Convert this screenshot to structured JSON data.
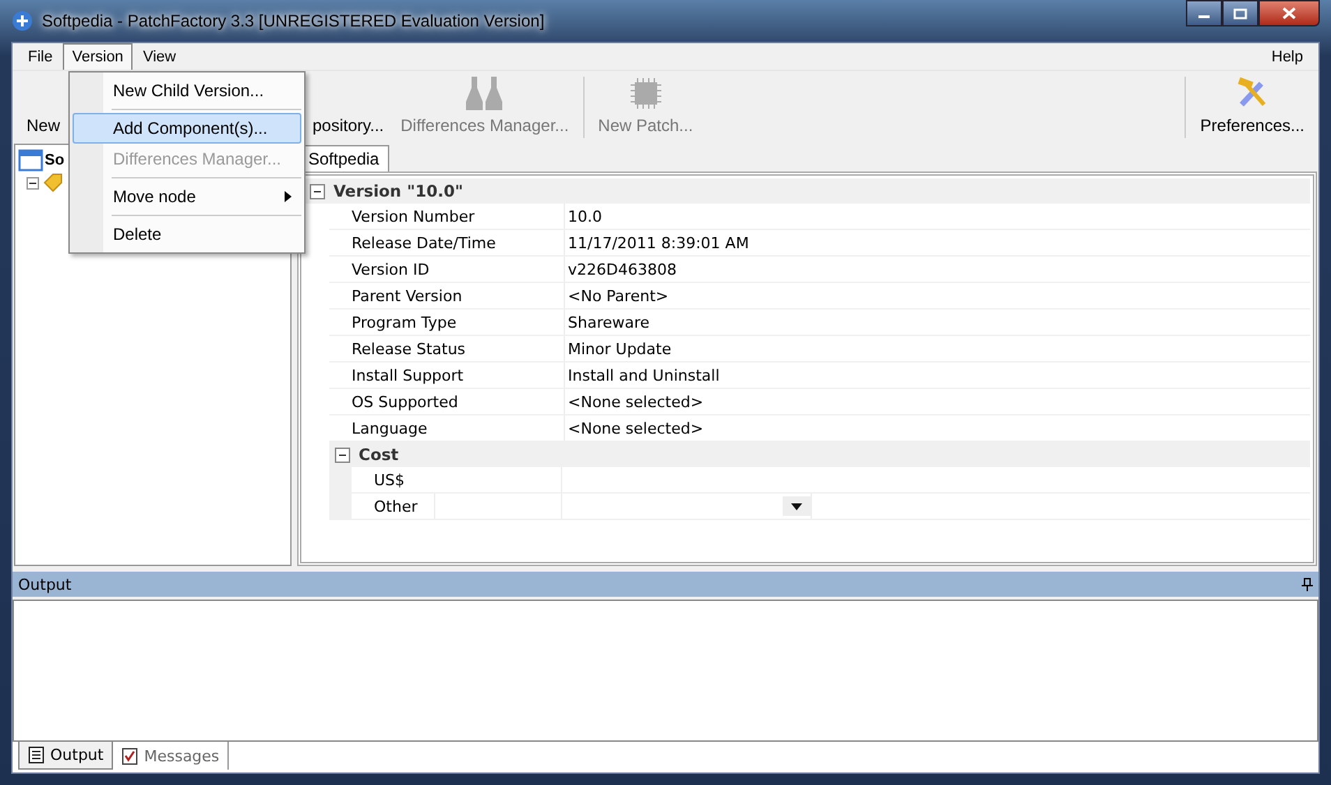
{
  "window": {
    "title": "Softpedia  -  PatchFactory 3.3  [UNREGISTERED Evaluation Version]"
  },
  "menu_bar": [
    {
      "label": "File",
      "selected": false
    },
    {
      "label": "Version",
      "selected": true
    },
    {
      "label": "View",
      "selected": false
    }
  ],
  "help_menu": "Help",
  "open_menu": [
    {
      "kind": "item",
      "label": "New Child Version...",
      "selected": false,
      "disabled": false
    },
    {
      "kind": "separator"
    },
    {
      "kind": "item",
      "label": "Add Component(s)...",
      "selected": true,
      "disabled": false
    },
    {
      "kind": "item",
      "label": "Differences Manager...",
      "selected": false,
      "disabled": true
    },
    {
      "kind": "separator"
    },
    {
      "kind": "submenu",
      "label": "Move node",
      "selected": false,
      "disabled": false
    },
    {
      "kind": "separator"
    },
    {
      "kind": "item",
      "label": "Delete",
      "selected": false,
      "disabled": false
    }
  ],
  "toolbar": [
    {
      "label": "New",
      "disabled": false
    },
    {
      "label": "pository...",
      "disabled": false
    },
    {
      "label": "Differences Manager...",
      "disabled": true
    },
    {
      "label": "New Patch...",
      "disabled": true
    }
  ],
  "toolbar_right": {
    "label": "Preferences...",
    "disabled": false
  },
  "tree": {
    "root": "So"
  },
  "document_tab": "Softpedia",
  "property_grid": {
    "section": "Version \"10.0\"",
    "expanded": true,
    "rows": [
      {
        "name": "Version Number",
        "value": "10.0"
      },
      {
        "name": "Release Date/Time",
        "value": "11/17/2011 8:39:01 AM"
      },
      {
        "name": "Version ID",
        "value": "v226D463808"
      },
      {
        "name": "Parent Version",
        "value": "<No Parent>"
      },
      {
        "name": "Program Type",
        "value": "Shareware"
      },
      {
        "name": "Release Status",
        "value": "Minor Update"
      },
      {
        "name": "Install Support",
        "value": "Install and Uninstall"
      },
      {
        "name": "OS Supported",
        "value": "<None selected>"
      },
      {
        "name": "Language",
        "value": "<None selected>"
      }
    ],
    "subsection": {
      "label": "Cost",
      "expanded": true,
      "rows": [
        {
          "name": "US$",
          "kind": "text"
        },
        {
          "name": "Other",
          "kind": "dropdown"
        }
      ]
    }
  },
  "output_panel": {
    "title": "Output",
    "tabs": [
      {
        "label": "Output",
        "selected": true
      },
      {
        "label": "Messages",
        "selected": false
      }
    ]
  }
}
